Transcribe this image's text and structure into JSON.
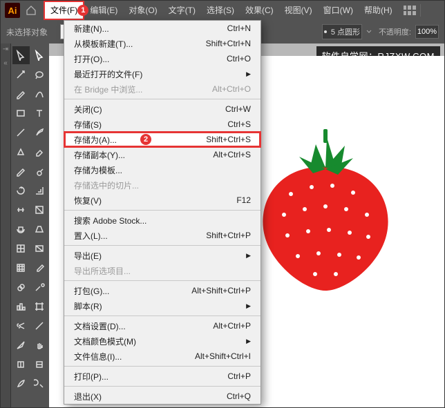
{
  "menubar": {
    "items": [
      "文件(F)",
      "编辑(E)",
      "对象(O)",
      "文字(T)",
      "选择(S)",
      "效果(C)",
      "视图(V)",
      "窗口(W)",
      "帮助(H)"
    ],
    "highlight_index": 0,
    "badge1": "1"
  },
  "ctrlbar": {
    "no_selection": "未选择对象",
    "stroke_label": "5 点圆形",
    "opacity_label": "不透明度:",
    "opacity_value": "100%"
  },
  "watermark": "软件自学网：RJZXW.COM",
  "dropdown": {
    "groups": [
      [
        {
          "label": "新建(N)...",
          "shortcut": "Ctrl+N"
        },
        {
          "label": "从模板新建(T)...",
          "shortcut": "Shift+Ctrl+N"
        },
        {
          "label": "打开(O)...",
          "shortcut": "Ctrl+O"
        },
        {
          "label": "最近打开的文件(F)",
          "shortcut": "",
          "arrow": true
        },
        {
          "label": "在 Bridge 中浏览...",
          "shortcut": "Alt+Ctrl+O",
          "disabled": true
        }
      ],
      [
        {
          "label": "关闭(C)",
          "shortcut": "Ctrl+W"
        },
        {
          "label": "存储(S)",
          "shortcut": "Ctrl+S"
        },
        {
          "label": "存储为(A)...",
          "shortcut": "Shift+Ctrl+S",
          "highlight": true,
          "badge": "2"
        },
        {
          "label": "存储副本(Y)...",
          "shortcut": "Alt+Ctrl+S"
        },
        {
          "label": "存储为模板...",
          "shortcut": ""
        },
        {
          "label": "存储选中的切片...",
          "shortcut": "",
          "disabled": true
        },
        {
          "label": "恢复(V)",
          "shortcut": "F12"
        }
      ],
      [
        {
          "label": "搜索 Adobe Stock...",
          "shortcut": ""
        },
        {
          "label": "置入(L)...",
          "shortcut": "Shift+Ctrl+P"
        }
      ],
      [
        {
          "label": "导出(E)",
          "shortcut": "",
          "arrow": true
        },
        {
          "label": "导出所选项目...",
          "shortcut": "",
          "disabled": true
        }
      ],
      [
        {
          "label": "打包(G)...",
          "shortcut": "Alt+Shift+Ctrl+P"
        },
        {
          "label": "脚本(R)",
          "shortcut": "",
          "arrow": true
        }
      ],
      [
        {
          "label": "文档设置(D)...",
          "shortcut": "Alt+Ctrl+P"
        },
        {
          "label": "文档颜色模式(M)",
          "shortcut": "",
          "arrow": true
        },
        {
          "label": "文件信息(I)...",
          "shortcut": "Alt+Shift+Ctrl+I"
        }
      ],
      [
        {
          "label": "打印(P)...",
          "shortcut": "Ctrl+P"
        }
      ],
      [
        {
          "label": "退出(X)",
          "shortcut": "Ctrl+Q"
        }
      ]
    ]
  },
  "tools": [
    "selection",
    "direct-selection",
    "magic-wand",
    "lasso",
    "pen",
    "curvature",
    "rectangle",
    "type",
    "line",
    "paintbrush",
    "shaper",
    "eraser",
    "pencil",
    "blob-brush",
    "rotate",
    "scale",
    "width",
    "free-transform",
    "shape-builder",
    "perspective",
    "mesh",
    "gradient",
    "grid",
    "eyedropper",
    "blend",
    "symbol-sprayer",
    "column-graph",
    "artboard",
    "scissors",
    "knife",
    "slice",
    "hand",
    "live-paint",
    "live-paint-select",
    "feather",
    "zoom"
  ]
}
